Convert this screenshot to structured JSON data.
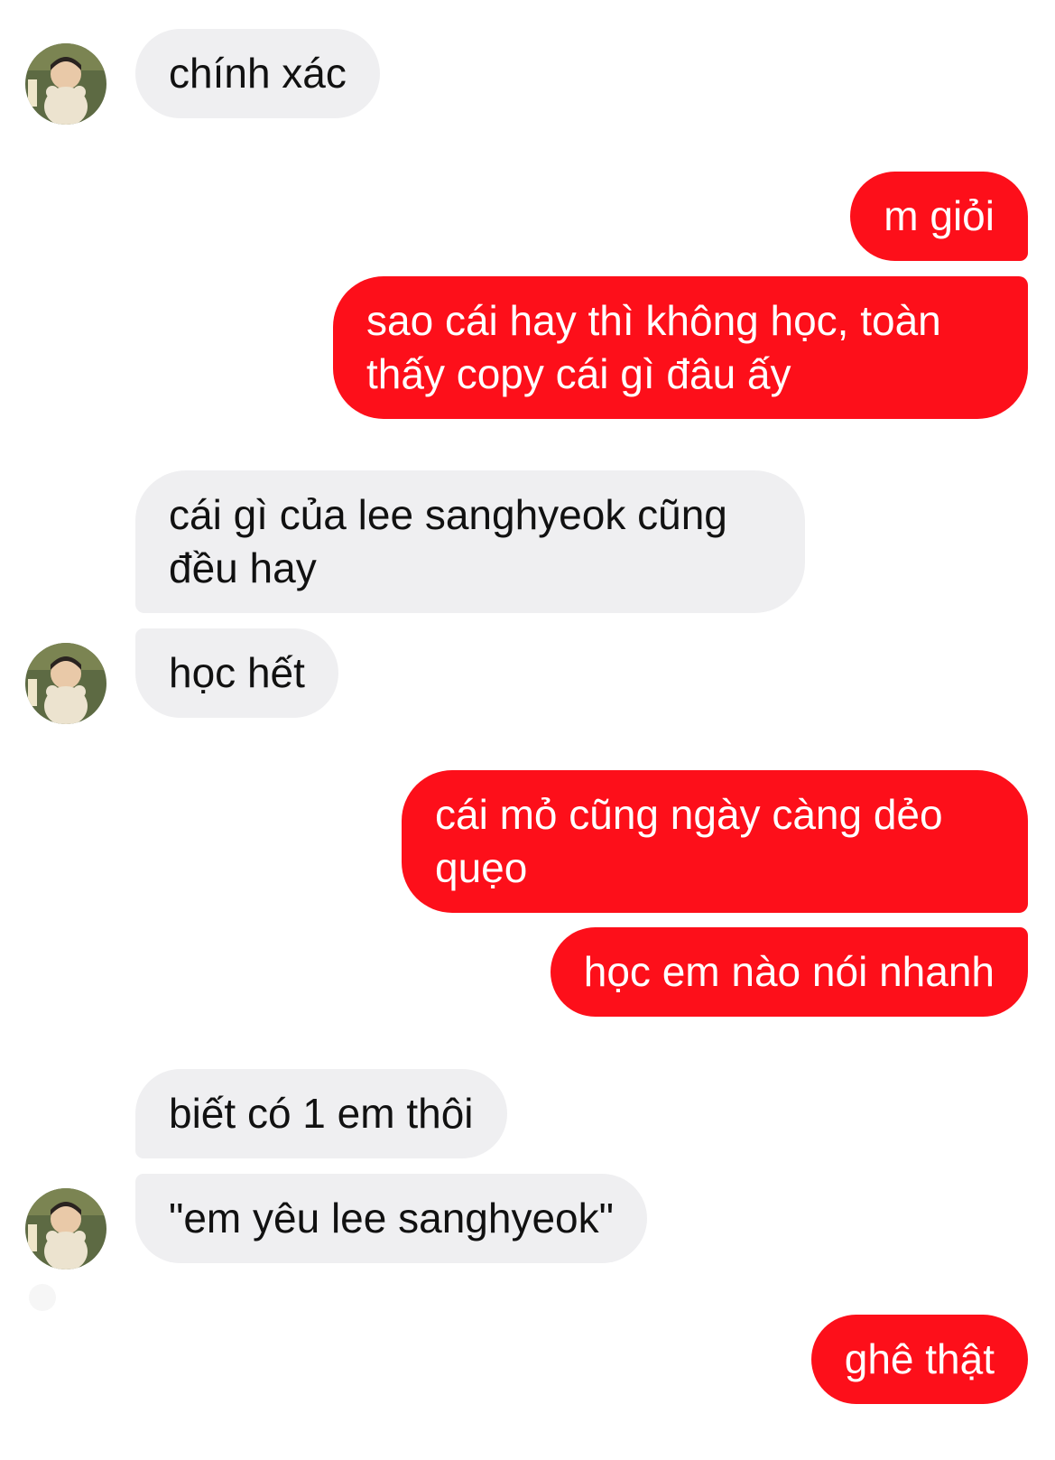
{
  "conversation": {
    "messages": [
      {
        "sender": "other",
        "text": "chính xác"
      },
      {
        "sender": "me",
        "text": "m giỏi"
      },
      {
        "sender": "me",
        "text": "sao cái hay thì không học, toàn thấy copy cái gì đâu ấy"
      },
      {
        "sender": "other",
        "text": "cái gì của lee sanghyeok cũng đều hay"
      },
      {
        "sender": "other",
        "text": "học hết"
      },
      {
        "sender": "me",
        "text": "cái mỏ cũng ngày càng dẻo quẹo"
      },
      {
        "sender": "me",
        "text": "học em nào nói nhanh"
      },
      {
        "sender": "other",
        "text": "biết có 1 em thôi"
      },
      {
        "sender": "other",
        "text": "\"em yêu lee sanghyeok\""
      },
      {
        "sender": "me",
        "text": "ghê thật"
      }
    ]
  },
  "colors": {
    "outgoing_bubble": "#fd0f1a",
    "incoming_bubble": "#efeff1",
    "background": "#ffffff"
  },
  "icons": {
    "avatar": "contact-avatar-icon"
  }
}
